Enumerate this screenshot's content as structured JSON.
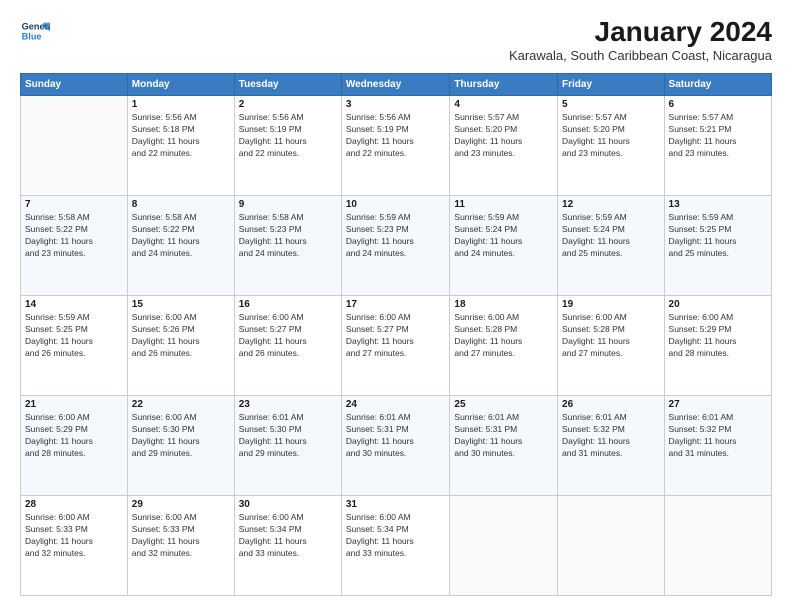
{
  "logo": {
    "line1": "General",
    "line2": "Blue"
  },
  "title": "January 2024",
  "subtitle": "Karawala, South Caribbean Coast, Nicaragua",
  "days_of_week": [
    "Sunday",
    "Monday",
    "Tuesday",
    "Wednesday",
    "Thursday",
    "Friday",
    "Saturday"
  ],
  "weeks": [
    [
      {
        "day": "",
        "info": ""
      },
      {
        "day": "1",
        "info": "Sunrise: 5:56 AM\nSunset: 5:18 PM\nDaylight: 11 hours\nand 22 minutes."
      },
      {
        "day": "2",
        "info": "Sunrise: 5:56 AM\nSunset: 5:19 PM\nDaylight: 11 hours\nand 22 minutes."
      },
      {
        "day": "3",
        "info": "Sunrise: 5:56 AM\nSunset: 5:19 PM\nDaylight: 11 hours\nand 22 minutes."
      },
      {
        "day": "4",
        "info": "Sunrise: 5:57 AM\nSunset: 5:20 PM\nDaylight: 11 hours\nand 23 minutes."
      },
      {
        "day": "5",
        "info": "Sunrise: 5:57 AM\nSunset: 5:20 PM\nDaylight: 11 hours\nand 23 minutes."
      },
      {
        "day": "6",
        "info": "Sunrise: 5:57 AM\nSunset: 5:21 PM\nDaylight: 11 hours\nand 23 minutes."
      }
    ],
    [
      {
        "day": "7",
        "info": "Sunrise: 5:58 AM\nSunset: 5:22 PM\nDaylight: 11 hours\nand 23 minutes."
      },
      {
        "day": "8",
        "info": "Sunrise: 5:58 AM\nSunset: 5:22 PM\nDaylight: 11 hours\nand 24 minutes."
      },
      {
        "day": "9",
        "info": "Sunrise: 5:58 AM\nSunset: 5:23 PM\nDaylight: 11 hours\nand 24 minutes."
      },
      {
        "day": "10",
        "info": "Sunrise: 5:59 AM\nSunset: 5:23 PM\nDaylight: 11 hours\nand 24 minutes."
      },
      {
        "day": "11",
        "info": "Sunrise: 5:59 AM\nSunset: 5:24 PM\nDaylight: 11 hours\nand 24 minutes."
      },
      {
        "day": "12",
        "info": "Sunrise: 5:59 AM\nSunset: 5:24 PM\nDaylight: 11 hours\nand 25 minutes."
      },
      {
        "day": "13",
        "info": "Sunrise: 5:59 AM\nSunset: 5:25 PM\nDaylight: 11 hours\nand 25 minutes."
      }
    ],
    [
      {
        "day": "14",
        "info": "Sunrise: 5:59 AM\nSunset: 5:25 PM\nDaylight: 11 hours\nand 26 minutes."
      },
      {
        "day": "15",
        "info": "Sunrise: 6:00 AM\nSunset: 5:26 PM\nDaylight: 11 hours\nand 26 minutes."
      },
      {
        "day": "16",
        "info": "Sunrise: 6:00 AM\nSunset: 5:27 PM\nDaylight: 11 hours\nand 26 minutes."
      },
      {
        "day": "17",
        "info": "Sunrise: 6:00 AM\nSunset: 5:27 PM\nDaylight: 11 hours\nand 27 minutes."
      },
      {
        "day": "18",
        "info": "Sunrise: 6:00 AM\nSunset: 5:28 PM\nDaylight: 11 hours\nand 27 minutes."
      },
      {
        "day": "19",
        "info": "Sunrise: 6:00 AM\nSunset: 5:28 PM\nDaylight: 11 hours\nand 27 minutes."
      },
      {
        "day": "20",
        "info": "Sunrise: 6:00 AM\nSunset: 5:29 PM\nDaylight: 11 hours\nand 28 minutes."
      }
    ],
    [
      {
        "day": "21",
        "info": "Sunrise: 6:00 AM\nSunset: 5:29 PM\nDaylight: 11 hours\nand 28 minutes."
      },
      {
        "day": "22",
        "info": "Sunrise: 6:00 AM\nSunset: 5:30 PM\nDaylight: 11 hours\nand 29 minutes."
      },
      {
        "day": "23",
        "info": "Sunrise: 6:01 AM\nSunset: 5:30 PM\nDaylight: 11 hours\nand 29 minutes."
      },
      {
        "day": "24",
        "info": "Sunrise: 6:01 AM\nSunset: 5:31 PM\nDaylight: 11 hours\nand 30 minutes."
      },
      {
        "day": "25",
        "info": "Sunrise: 6:01 AM\nSunset: 5:31 PM\nDaylight: 11 hours\nand 30 minutes."
      },
      {
        "day": "26",
        "info": "Sunrise: 6:01 AM\nSunset: 5:32 PM\nDaylight: 11 hours\nand 31 minutes."
      },
      {
        "day": "27",
        "info": "Sunrise: 6:01 AM\nSunset: 5:32 PM\nDaylight: 11 hours\nand 31 minutes."
      }
    ],
    [
      {
        "day": "28",
        "info": "Sunrise: 6:00 AM\nSunset: 5:33 PM\nDaylight: 11 hours\nand 32 minutes."
      },
      {
        "day": "29",
        "info": "Sunrise: 6:00 AM\nSunset: 5:33 PM\nDaylight: 11 hours\nand 32 minutes."
      },
      {
        "day": "30",
        "info": "Sunrise: 6:00 AM\nSunset: 5:34 PM\nDaylight: 11 hours\nand 33 minutes."
      },
      {
        "day": "31",
        "info": "Sunrise: 6:00 AM\nSunset: 5:34 PM\nDaylight: 11 hours\nand 33 minutes."
      },
      {
        "day": "",
        "info": ""
      },
      {
        "day": "",
        "info": ""
      },
      {
        "day": "",
        "info": ""
      }
    ]
  ]
}
